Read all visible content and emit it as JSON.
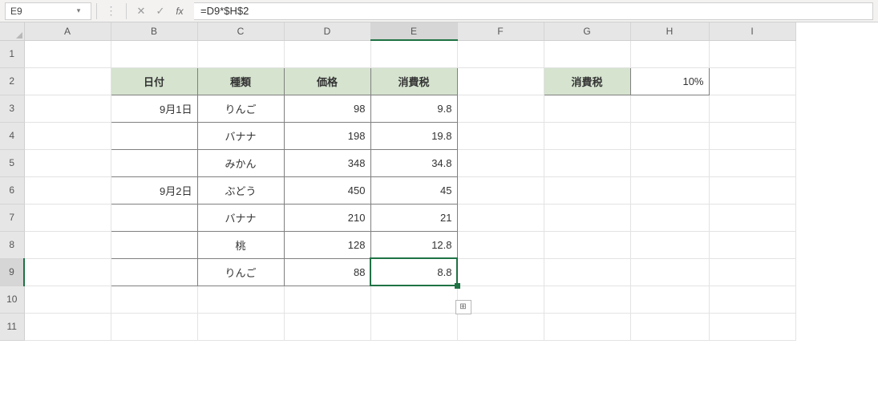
{
  "formula_bar": {
    "name_box": "E9",
    "fx_label": "fx",
    "formula": "=D9*$H$2"
  },
  "columns": [
    "A",
    "B",
    "C",
    "D",
    "E",
    "F",
    "G",
    "H",
    "I"
  ],
  "rows": [
    "1",
    "2",
    "3",
    "4",
    "5",
    "6",
    "7",
    "8",
    "9",
    "10",
    "11"
  ],
  "selected": {
    "col": "E",
    "row": "9"
  },
  "headers": {
    "date": "日付",
    "kind": "種類",
    "price": "価格",
    "tax": "消費税",
    "tax_label": "消費税"
  },
  "tax_rate": "10%",
  "data_rows": [
    {
      "date": "9月1日",
      "kind": "りんご",
      "price": "98",
      "tax": "9.8"
    },
    {
      "date": "",
      "kind": "バナナ",
      "price": "198",
      "tax": "19.8"
    },
    {
      "date": "",
      "kind": "みかん",
      "price": "348",
      "tax": "34.8"
    },
    {
      "date": "9月2日",
      "kind": "ぶどう",
      "price": "450",
      "tax": "45"
    },
    {
      "date": "",
      "kind": "バナナ",
      "price": "210",
      "tax": "21"
    },
    {
      "date": "",
      "kind": "桃",
      "price": "128",
      "tax": "12.8"
    },
    {
      "date": "",
      "kind": "りんご",
      "price": "88",
      "tax": "8.8"
    }
  ],
  "icons": {
    "dropdown": "▾",
    "dots": "⋮",
    "cancel": "✕",
    "confirm": "✓",
    "autofill": "⊞"
  }
}
